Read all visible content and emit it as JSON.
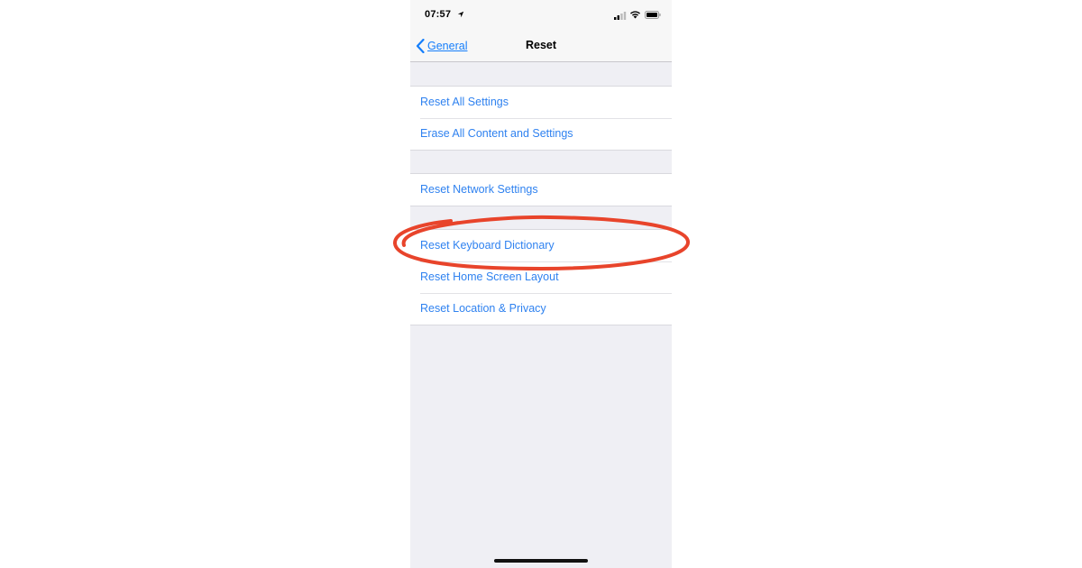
{
  "status_bar": {
    "time": "07:57"
  },
  "nav": {
    "back_label": "General",
    "title": "Reset"
  },
  "groups": [
    {
      "items": [
        {
          "label": "Reset All Settings"
        },
        {
          "label": "Erase All Content and Settings"
        }
      ]
    },
    {
      "items": [
        {
          "label": "Reset Network Settings"
        }
      ]
    },
    {
      "items": [
        {
          "label": "Reset Keyboard Dictionary"
        },
        {
          "label": "Reset Home Screen Layout"
        },
        {
          "label": "Reset Location & Privacy"
        }
      ]
    }
  ],
  "colors": {
    "accent": "#157efb",
    "annotation": "#e8442b",
    "background": "#efeff4"
  },
  "icons": [
    "location-arrow-icon",
    "signal-icon",
    "wifi-icon",
    "battery-icon",
    "chevron-left-icon"
  ]
}
